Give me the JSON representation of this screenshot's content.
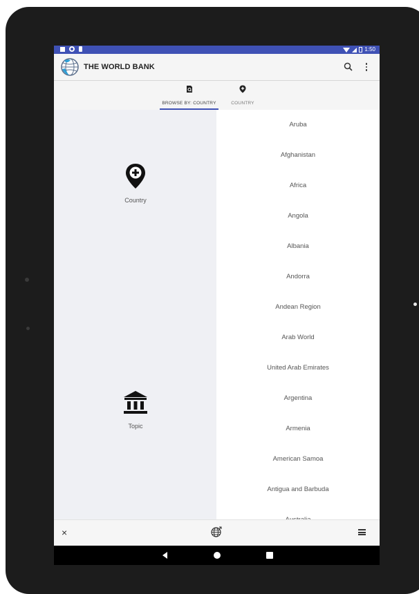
{
  "status_bar": {
    "time": "1:50"
  },
  "app_bar": {
    "title": "THE WORLD BANK",
    "icons": [
      "world-bank-logo-icon",
      "search-icon",
      "more-vert-icon"
    ]
  },
  "tabs": [
    {
      "label": "BROWSE BY: COUNTRY",
      "icon": "document-search-icon",
      "selected": true
    },
    {
      "label": "COUNTRY",
      "icon": "location-add-icon",
      "selected": false
    }
  ],
  "categories": [
    {
      "label": "Country",
      "icon": "location-add-icon"
    },
    {
      "label": "Topic",
      "icon": "bank-building-icon"
    }
  ],
  "countries": [
    "Aruba",
    "Afghanistan",
    "Africa",
    "Angola",
    "Albania",
    "Andorra",
    "Andean Region",
    "Arab World",
    "United Arab Emirates",
    "Argentina",
    "Armenia",
    "American Samoa",
    "Antigua and Barbuda",
    "Australia"
  ],
  "bottom_bar": {
    "icons": [
      "close-icon",
      "globe-icon",
      "list-icon"
    ],
    "close_glyph": "×"
  },
  "colors": {
    "accent": "#3f51b5",
    "left_pane_bg": "#eff0f4",
    "text": "#555555"
  }
}
